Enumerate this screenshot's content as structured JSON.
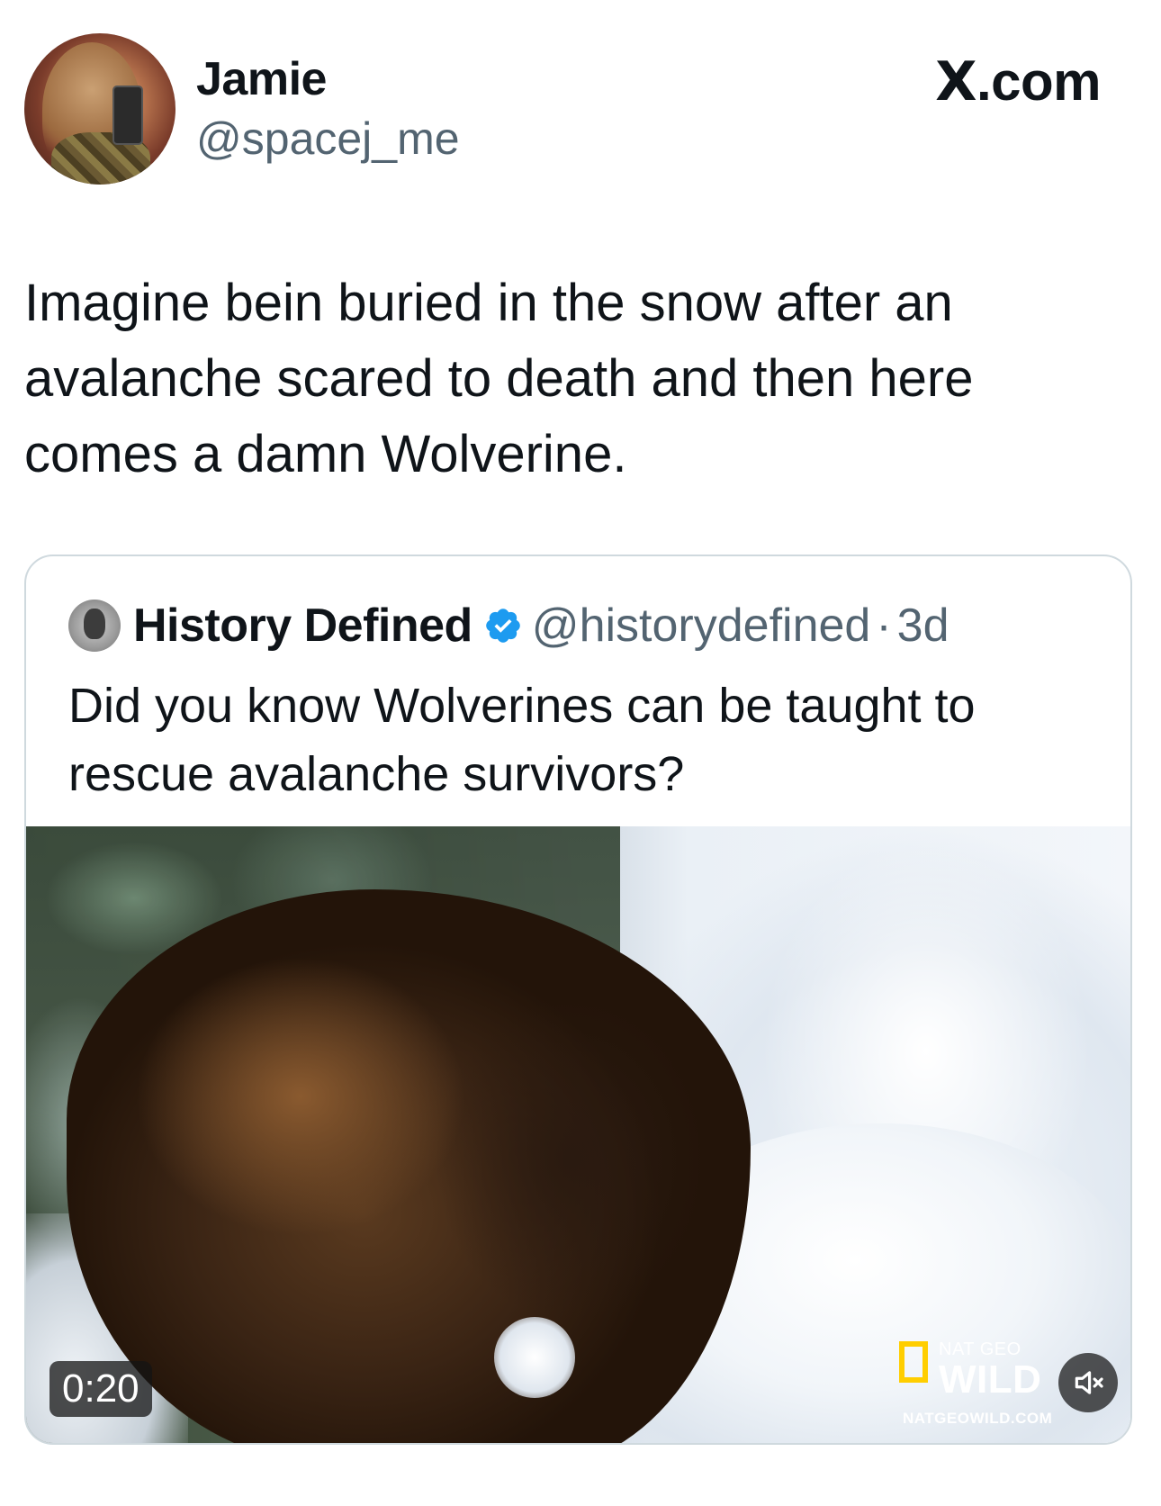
{
  "author": {
    "name": "Jamie",
    "handle": "@spacej_me"
  },
  "site": {
    "logo_text": ".com",
    "logo_mark": "X"
  },
  "tweet": {
    "text": "Imagine bein buried in the snow after an avalanche scared to death and then here comes a damn Wolverine."
  },
  "quoted": {
    "name": "History Defined",
    "handle": "@historydefined",
    "separator": "·",
    "time": "3d",
    "text": "Did you know Wolverines can be taught to rescue avalanche survivors?",
    "verified": true,
    "verified_color": "#1d9bf0"
  },
  "video": {
    "duration": "0:20",
    "watermark": {
      "line1": "NAT GEO",
      "line2": "WILD",
      "line3": "NATGEOWILD.COM"
    },
    "mute_icon": "speaker-muted-icon"
  },
  "colors": {
    "text": "#0f1419",
    "secondary": "#536471",
    "border": "#cfd9de",
    "natgeo_yellow": "#ffce00"
  }
}
